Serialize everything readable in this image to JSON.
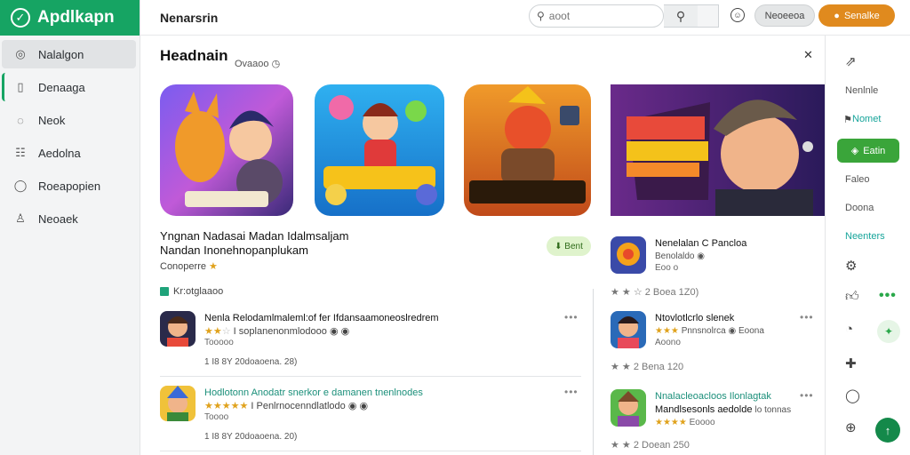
{
  "sidebar": {
    "brand": "Apdlkapn",
    "items": [
      {
        "label": "Nalalgon",
        "icon": "globe-icon"
      },
      {
        "label": "Denaaga",
        "icon": "bookmark-icon"
      },
      {
        "label": "Neok",
        "icon": "chat-icon"
      },
      {
        "label": "Aedolna",
        "icon": "list-icon"
      },
      {
        "label": "Roeapopien",
        "icon": "message-icon"
      },
      {
        "label": "Neoaek",
        "icon": "user-icon"
      }
    ]
  },
  "header": {
    "title": "Nenarsrin",
    "search_placeholder": "aoot",
    "pill_gray": "Neoeeoa",
    "pill_orange": "Senalke"
  },
  "main": {
    "section_title": "Headnain",
    "section_sub": "Ovaaoo",
    "featured_title_line1": "Yngnan Nadasai Madan Idalmsaljam",
    "featured_title_line2": "Nandan Inonehnopanplukam",
    "featured_meta": "Conoperre",
    "get_label": "Bent",
    "filter_label": "Kr:otglaaoo",
    "apps": [
      {
        "name": "Nenla Relodamlmaleml:of  fer  Ifdansaamoneoslredrem",
        "stars": 2,
        "stars_text": "I soplanenonmlodooo",
        "extra": "Tooooo",
        "date": "1 I8  8Y  20doaoena. 28)"
      },
      {
        "name": "Hodlotonn Anodatr snerkor e damanen tnenlnodes",
        "stars": 5,
        "stars_text": "I Penlrnocenndlatlodo",
        "extra": "Toooo",
        "date": "1 I8  8Y  20doaoena. 20)"
      }
    ],
    "side_apps": [
      {
        "name": "Nenelalan C Pancloa",
        "sub": "Benolaldo",
        "extra": "Eoo o",
        "rating": "★ ★   ☆ 2 Boea 1Z0)"
      },
      {
        "name": "Ntovlotlcrlo slenek",
        "sub": "Pnnsnolrca",
        "sub_tail": "Eoona",
        "extra": "Aoono",
        "rating": "★ ★   2 Bena 120"
      },
      {
        "name": "Nnalacleoacloos Ilonlagtak",
        "name2": "Mandlsesonls aedolde",
        "name2_tail": "lo tonnas",
        "extra": "Eoooo",
        "rating": "★ ★   2 Doean 250"
      }
    ]
  },
  "rail": {
    "items": [
      "Nenlnle",
      "Nomet",
      "Faleo",
      "Doona",
      "Neenters"
    ],
    "button": "Eatin"
  },
  "colors": {
    "brand_green": "#16a463",
    "accent_orange": "#e08a1e",
    "star": "#e0a21c",
    "teal": "#1b8f7a"
  }
}
